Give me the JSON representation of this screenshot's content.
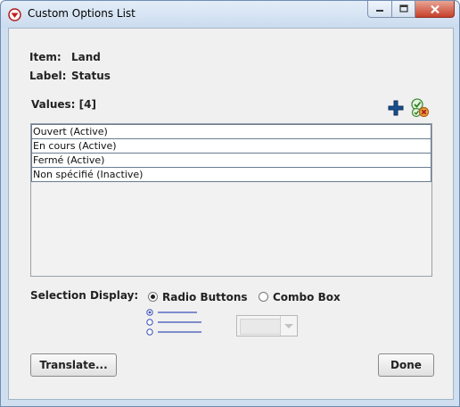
{
  "window": {
    "title": "Custom Options List"
  },
  "item": {
    "label": "Item:",
    "value": "Land"
  },
  "label_field": {
    "label": "Label:",
    "value": "Status"
  },
  "values": {
    "heading": "Values: [4]",
    "items": [
      "Ouvert (Active)",
      "En cours (Active)",
      "Fermé (Active)",
      "Non spécifié (Inactive)"
    ]
  },
  "selection_display": {
    "label": "Selection Display:",
    "options": [
      {
        "label": "Radio Buttons",
        "selected": true
      },
      {
        "label": "Combo Box",
        "selected": false
      }
    ]
  },
  "buttons": {
    "translate": "Translate...",
    "done": "Done"
  },
  "icons": {
    "add": "plus-icon",
    "validate": "check-x-icon",
    "app": "app-logo-icon"
  },
  "colors": {
    "title_bg": "#cbdcef",
    "panel_bg": "#f0f0f0",
    "add_icon": "#1a4f8f",
    "close_button": "#c7402a"
  }
}
